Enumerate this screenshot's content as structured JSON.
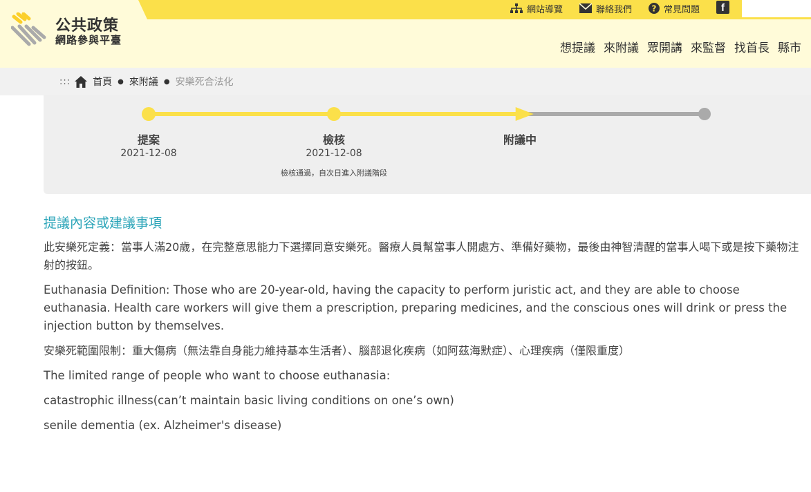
{
  "colors": {
    "accent_yellow": "#fbe04a",
    "header_bg": "#fffbd9",
    "section_title": "#2aa4b8",
    "track_gray": "#aaaaaa"
  },
  "logo": {
    "title": "公共政策",
    "subtitle": "網路參與平臺",
    "icon": "hand-stripes-logo-icon"
  },
  "utility_nav": [
    {
      "label": "網站導覽",
      "icon": "sitemap-icon"
    },
    {
      "label": "聯絡我們",
      "icon": "envelope-icon"
    },
    {
      "label": "常見問題",
      "icon": "question-circle-icon"
    }
  ],
  "social": {
    "facebook_glyph": "f",
    "icon": "facebook-icon"
  },
  "main_nav": [
    "想提議",
    "來附議",
    "眾開講",
    "來監督",
    "找首長",
    "縣市"
  ],
  "breadcrumb": {
    "prefix": ":::",
    "home": "首頁",
    "level1": "來附議",
    "current": "安樂死合法化"
  },
  "progress": {
    "completed_fraction": 0.68,
    "steps": [
      {
        "label": "提案",
        "date": "2021-12-08",
        "note": ""
      },
      {
        "label": "檢核",
        "date": "2021-12-08",
        "note": "檢核通過，自次日進入附議階段"
      },
      {
        "label": "附議中",
        "date": "",
        "note": ""
      },
      {
        "label": "",
        "date": "",
        "note": ""
      }
    ]
  },
  "content": {
    "section_title": "提議內容或建議事項",
    "paragraphs": [
      "此安樂死定義：當事人滿20歲，在完整意思能力下選擇同意安樂死。醫療人員幫當事人開處方、準備好藥物，最後由神智清醒的當事人喝下或是按下藥物注射的按鈕。",
      "Euthanasia Definition: Those who are 20-year-old, having the capacity to perform juristic act, and they are able to choose euthanasia. Health care workers will give them a prescription, preparing medicines, and the conscious ones will drink or press the injection button by themselves.",
      "安樂死範圍限制：重大傷病（無法靠自身能力維持基本生活者）、腦部退化疾病（如阿茲海默症）、心理疾病（僅限重度）",
      "The limited range of people who want to choose euthanasia:",
      "catastrophic illness(can’t maintain basic living conditions on one’s own)",
      "senile dementia (ex. Alzheimer's disease)"
    ]
  }
}
